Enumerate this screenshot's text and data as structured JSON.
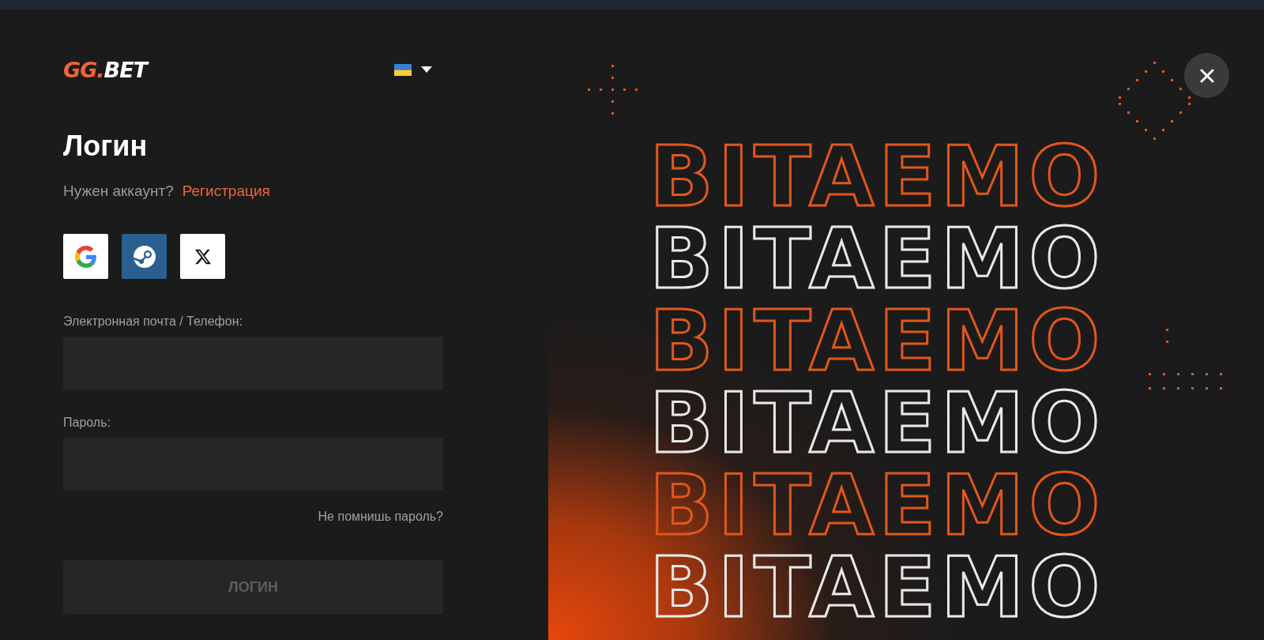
{
  "logo": {
    "accent": "GG.",
    "rest": "BET"
  },
  "title": "Логин",
  "signup": {
    "prompt": "Нужен аккаунт?",
    "link": "Регистрация"
  },
  "social_buttons": [
    {
      "kind": "google"
    },
    {
      "kind": "steam"
    },
    {
      "kind": "x"
    }
  ],
  "fields": [
    {
      "label": "Электронная почта / Телефон:"
    },
    {
      "label": "Пароль:"
    }
  ],
  "forgot_link": "Не помнишь пароль?",
  "login_button": {
    "label": "ЛОГИН",
    "disabled": true
  },
  "promo": {
    "lines": [
      {
        "text": "BITAEMO",
        "highlighted": true
      },
      {
        "text": "BITAEMO",
        "highlighted": false
      },
      {
        "text": "BITAEMO",
        "highlighted": true
      },
      {
        "text": "BITAEMO",
        "highlighted": false
      },
      {
        "text": "BITAEMO",
        "highlighted": true
      },
      {
        "text": "BITAEMO",
        "highlighted": false
      }
    ]
  }
}
